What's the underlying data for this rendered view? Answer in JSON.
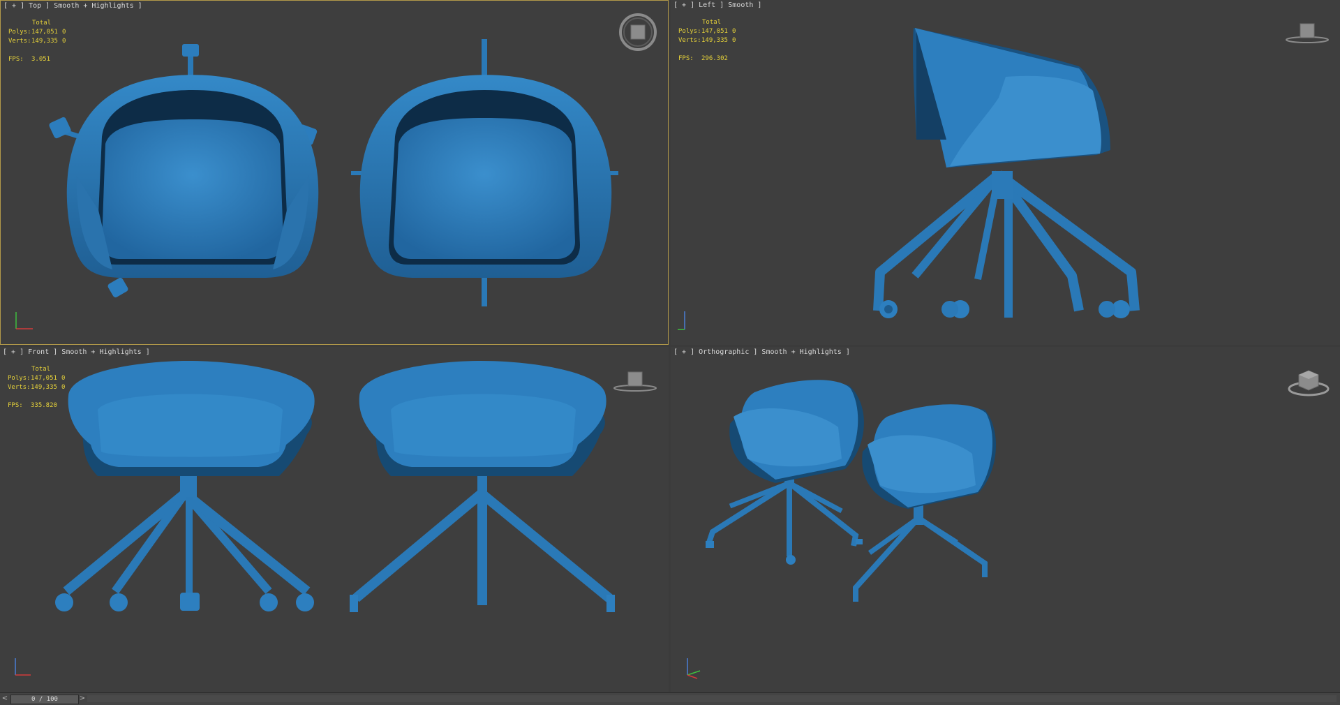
{
  "viewports": {
    "top": {
      "label": "[ + ] Top ] Smooth + Highlights ]",
      "stats": {
        "header": "Total",
        "polys_label": "Polys:",
        "polys": "147,051",
        "polys_sel": "0",
        "verts_label": "Verts:",
        "verts": "149,335",
        "verts_sel": "0",
        "fps_label": "FPS:",
        "fps": "3.051"
      },
      "navcube": "top-viewcube-icon"
    },
    "left": {
      "label": "[ + ] Left ] Smooth ]",
      "stats": {
        "header": "Total",
        "polys_label": "Polys:",
        "polys": "147,051",
        "polys_sel": "0",
        "verts_label": "Verts:",
        "verts": "149,335",
        "verts_sel": "0",
        "fps_label": "FPS:",
        "fps": "296.302"
      },
      "navcube": "left-viewcube-icon"
    },
    "front": {
      "label": "[ + ] Front ] Smooth + Highlights ]",
      "stats": {
        "header": "Total",
        "polys_label": "Polys:",
        "polys": "147,051",
        "polys_sel": "0",
        "verts_label": "Verts:",
        "verts": "149,335",
        "verts_sel": "0",
        "fps_label": "FPS:",
        "fps": "335.820"
      },
      "navcube": "front-viewcube-icon"
    },
    "ortho": {
      "label": "[ + ] Orthographic ] Smooth + Highlights ]",
      "navcube": "orthographic-viewcube-icon"
    }
  },
  "timeslider": {
    "value": "0 / 100",
    "prev_icon": "chevron-left-icon",
    "next_icon": "chevron-right-icon"
  },
  "colors": {
    "model": "#2d7fbf",
    "model_dark": "#164a73",
    "model_light": "#4a9ad6",
    "viewport_bg": "#3e3e3e",
    "active_border": "#b39a4a",
    "stats_text": "#e6d23a"
  }
}
